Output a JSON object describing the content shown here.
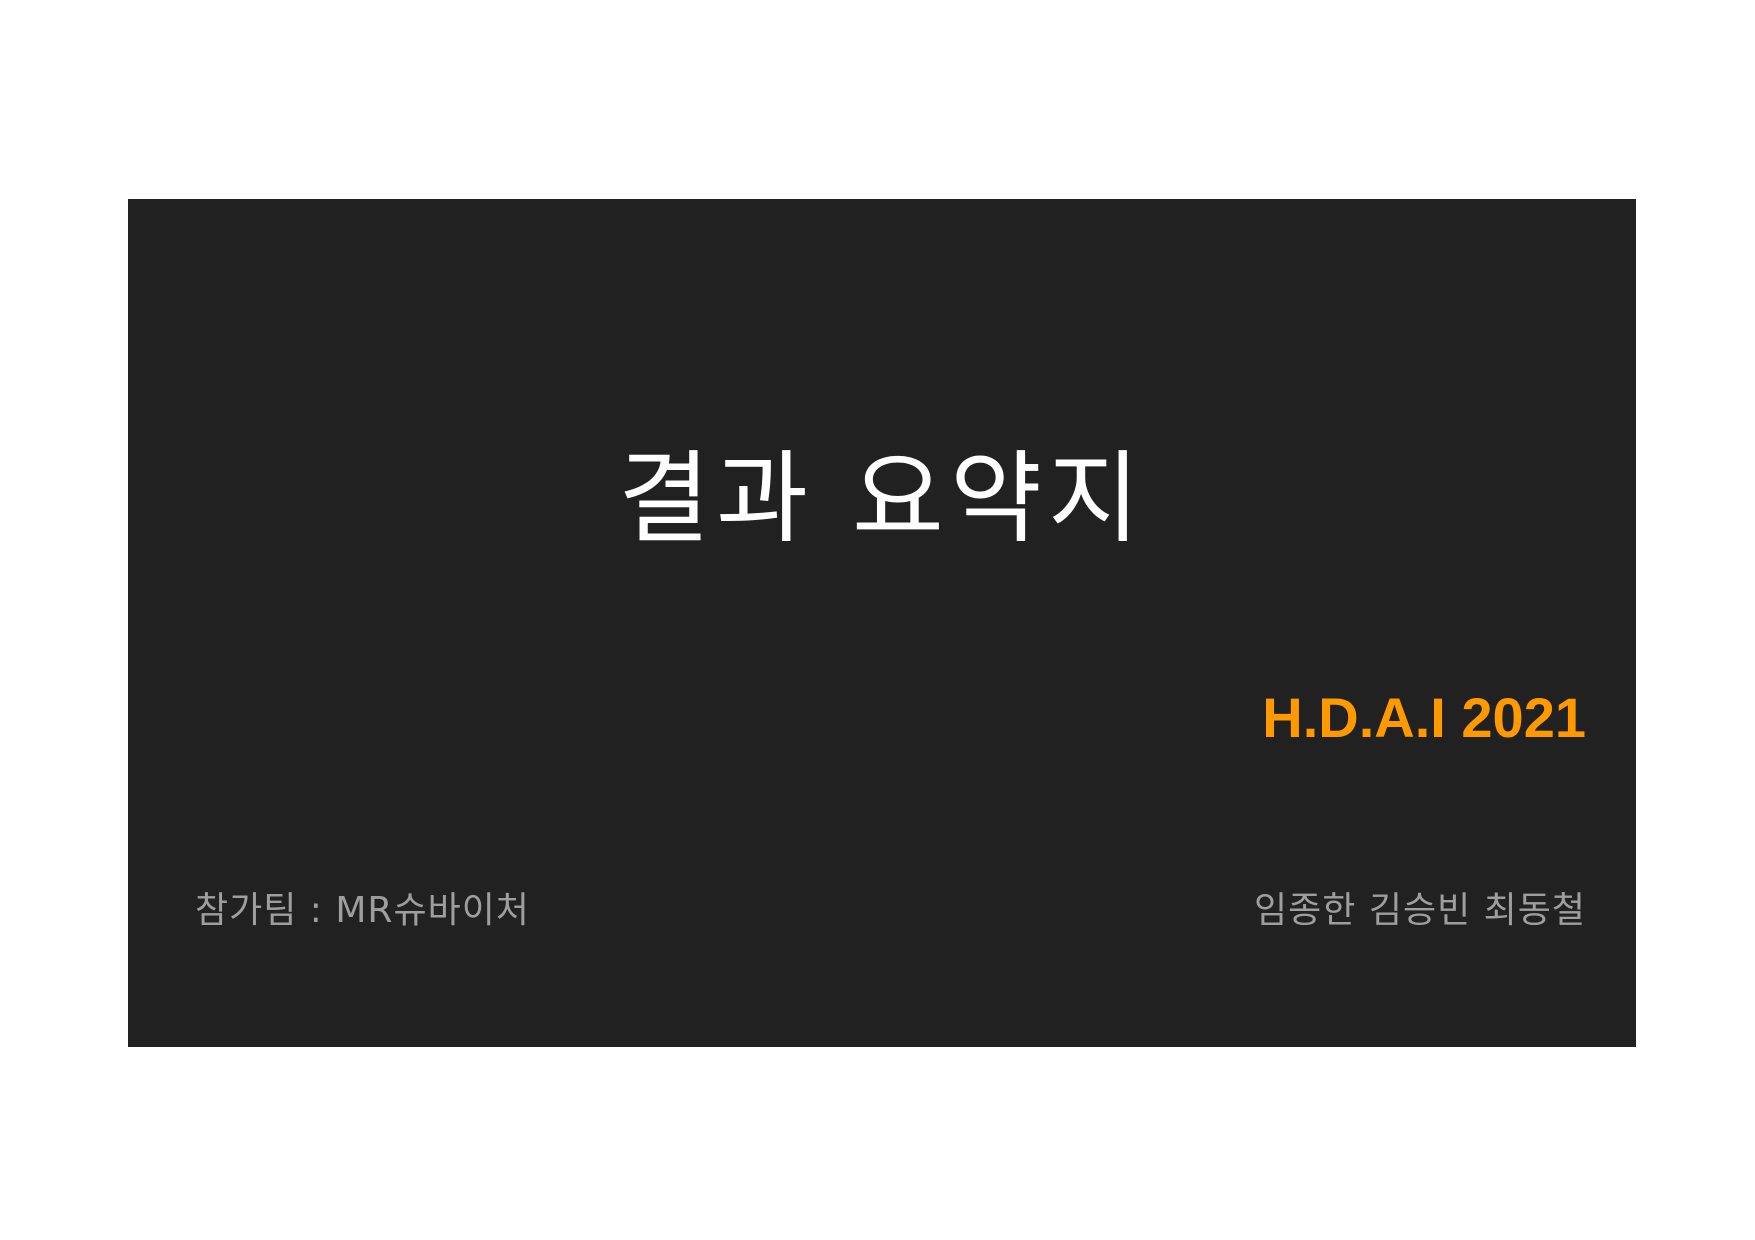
{
  "slide": {
    "title": "결과 요약지",
    "event": "H.D.A.I 2021",
    "team": "참가팀 : MR슈바이처",
    "members": "임종한 김승빈 최동철"
  },
  "colors": {
    "background": "#212121",
    "title": "#ffffff",
    "accent": "#ff9900",
    "muted_text": "#9e9e9e"
  }
}
